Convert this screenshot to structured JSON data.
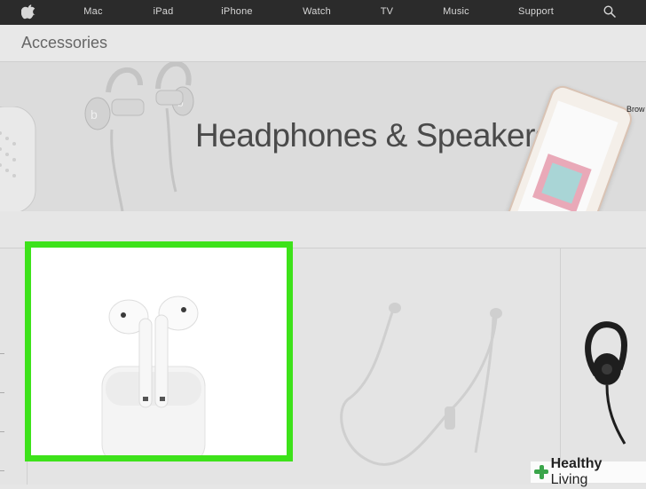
{
  "nav": {
    "items": [
      "Mac",
      "iPad",
      "iPhone",
      "Watch",
      "TV",
      "Music",
      "Support"
    ],
    "apple_icon": "apple-logo-icon",
    "search_icon": "search-icon"
  },
  "breadcrumb": {
    "title": "Accessories"
  },
  "hero": {
    "headline": "Headphones & Speakers",
    "browse_hint": "Brow"
  },
  "products": [
    {
      "name": "AirPods",
      "highlighted": true,
      "highlight_color": "#3de21a"
    },
    {
      "name": "Wireless earphones"
    },
    {
      "name": "Over-ear sport headphones"
    }
  ],
  "watermark": {
    "bold": "Healthy",
    "light": "Living"
  },
  "colors": {
    "nav_bg": "#2b2b2b",
    "highlight": "#3de21a",
    "page_bg": "#e6e6e6"
  }
}
